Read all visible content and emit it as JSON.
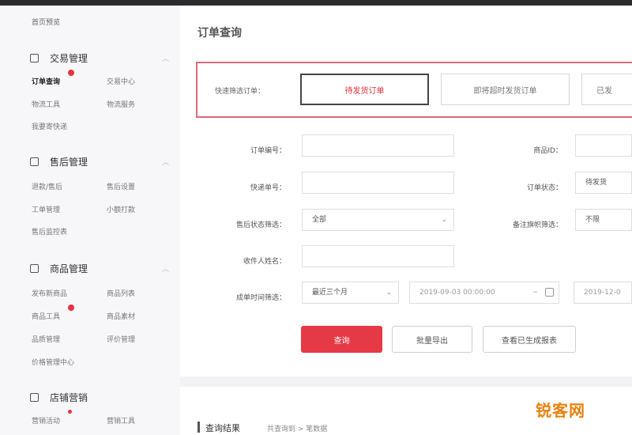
{
  "sidebar": {
    "top_link": "首页预览",
    "sections": [
      {
        "title": "交易管理",
        "items": [
          {
            "label": "订单查询",
            "active": true,
            "badge": true
          },
          {
            "label": "交易中心",
            "active": false,
            "badge": false
          },
          {
            "label": "物流工具",
            "active": false,
            "badge": false
          },
          {
            "label": "物流服务",
            "active": false,
            "badge": false
          },
          {
            "label": "我要寄快递",
            "active": false,
            "badge": false
          }
        ]
      },
      {
        "title": "售后管理",
        "items": [
          {
            "label": "退款/售后",
            "active": false,
            "badge": false
          },
          {
            "label": "售后设置",
            "active": false,
            "badge": false
          },
          {
            "label": "工单管理",
            "active": false,
            "badge": false
          },
          {
            "label": "小额打款",
            "active": false,
            "badge": false
          },
          {
            "label": "售后监控表",
            "active": false,
            "badge": false
          }
        ]
      },
      {
        "title": "商品管理",
        "items": [
          {
            "label": "发布新商品",
            "active": false,
            "badge": false
          },
          {
            "label": "商品列表",
            "active": false,
            "badge": false
          },
          {
            "label": "商品工具",
            "active": false,
            "badge": true
          },
          {
            "label": "商品素材",
            "active": false,
            "badge": false
          },
          {
            "label": "品质管理",
            "active": false,
            "badge": false
          },
          {
            "label": "评价管理",
            "active": false,
            "badge": false
          },
          {
            "label": "价格管理中心",
            "active": false,
            "badge": false
          }
        ]
      },
      {
        "title": "店铺营销",
        "items": [
          {
            "label": "营销活动",
            "active": false,
            "badge": true
          },
          {
            "label": "营销工具",
            "active": false,
            "badge": false
          }
        ]
      }
    ]
  },
  "main": {
    "title": "订单查询",
    "filter": {
      "label": "快速筛选订单：",
      "segments": [
        {
          "label": "待发货订单",
          "active": true
        },
        {
          "label": "即将超时发货订单",
          "active": false
        },
        {
          "label": "已发",
          "active": false
        }
      ]
    },
    "fields": [
      {
        "label": "订单编号：",
        "value": ""
      },
      {
        "label": "商品ID：",
        "value": ""
      },
      {
        "label": "快递单号：",
        "value": ""
      },
      {
        "label": "订单状态：",
        "value": "待发货"
      },
      {
        "label": "售后状态筛选：",
        "value": "全部"
      },
      {
        "label": "备注旗帜筛选：",
        "value": "不限"
      },
      {
        "label": "收件人姓名：",
        "value": ""
      },
      {
        "label": "成单时间筛选：",
        "value": "最近三个月"
      }
    ],
    "date_start": "2019-09-03 00:00:00",
    "date_end": "2019-12-0",
    "date_separator": "~",
    "buttons": {
      "query": "查询",
      "reset": "批量导出",
      "export": "查看已生成报表"
    },
    "results": {
      "title": "查询结果",
      "meta": "共查询到 > 笔数据"
    }
  },
  "watermark": "锐客网",
  "colors": {
    "accent": "#e63946",
    "highlight_border": "#e06a78",
    "watermark": "#e8820c"
  }
}
